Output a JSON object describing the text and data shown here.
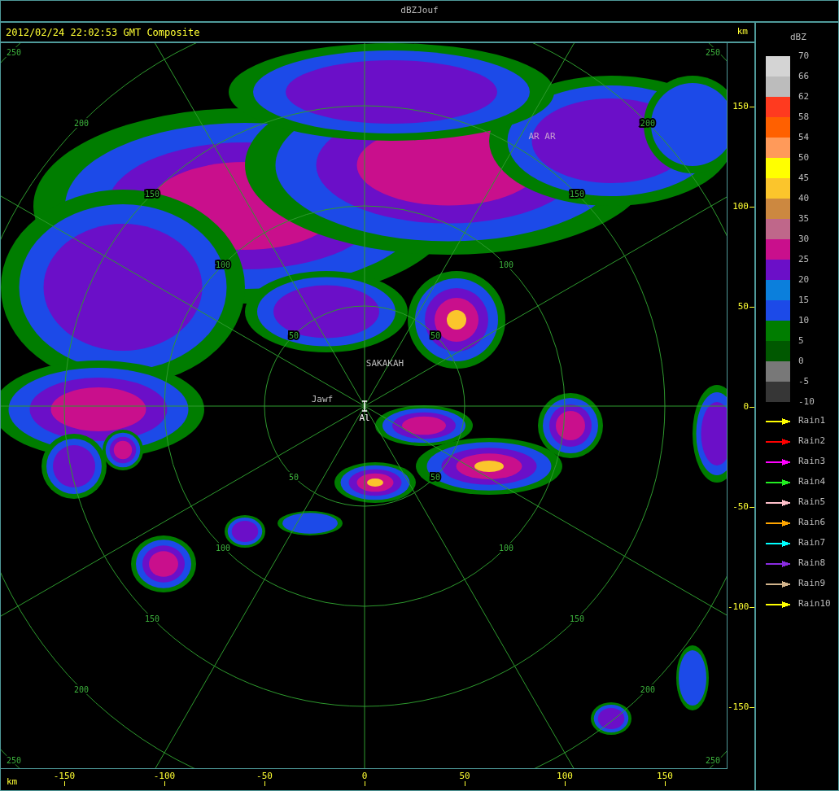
{
  "window": {
    "title": "dBZJouf"
  },
  "header": {
    "timestamp": "2012/02/24 22:02:53 GMT Composite"
  },
  "map": {
    "ring_labels": {
      "nw": [
        "50",
        "100",
        "150",
        "200",
        "250"
      ],
      "ne": [
        "50",
        "100",
        "150",
        "200",
        "250"
      ],
      "sw": [
        "50",
        "100",
        "150",
        "200",
        "250"
      ],
      "se": [
        "50",
        "100",
        "150",
        "200",
        "250"
      ]
    },
    "places": [
      {
        "name": "SAKAKAH"
      },
      {
        "name": "AR AR"
      },
      {
        "name": "Jawf"
      },
      {
        "name": "Al"
      }
    ]
  },
  "y_axis": {
    "unit": "km",
    "ticks": [
      "150",
      "100",
      "50",
      "0",
      "-50",
      "-100",
      "-150"
    ]
  },
  "x_axis": {
    "unit": "km",
    "ticks": [
      "-150",
      "-100",
      "-50",
      "0",
      "50",
      "100",
      "150"
    ]
  },
  "legend": {
    "title": "dBZ",
    "bottom_label": "-10",
    "bins": [
      {
        "label": "70",
        "color": "#d4d4d4"
      },
      {
        "label": "66",
        "color": "#bcbcbc"
      },
      {
        "label": "62",
        "color": "#ff3a1f"
      },
      {
        "label": "58",
        "color": "#ff6000"
      },
      {
        "label": "54",
        "color": "#ff9a5a"
      },
      {
        "label": "50",
        "color": "#ffff00"
      },
      {
        "label": "45",
        "color": "#fbc52c"
      },
      {
        "label": "40",
        "color": "#cc8840"
      },
      {
        "label": "35",
        "color": "#bf678a"
      },
      {
        "label": "30",
        "color": "#c90f8c"
      },
      {
        "label": "25",
        "color": "#6b0fc8"
      },
      {
        "label": "20",
        "color": "#0b7fdc"
      },
      {
        "label": "15",
        "color": "#1c4ae8"
      },
      {
        "label": "10",
        "color": "#007d00"
      },
      {
        "label": "5",
        "color": "#005800"
      },
      {
        "label": "0",
        "color": "#787878"
      },
      {
        "label": "-5",
        "color": "#363636"
      }
    ],
    "tracks": [
      {
        "label": "Rain1",
        "color": "#ffff00"
      },
      {
        "label": "Rain2",
        "color": "#ff0000"
      },
      {
        "label": "Rain3",
        "color": "#ff00ff"
      },
      {
        "label": "Rain4",
        "color": "#22ee22"
      },
      {
        "label": "Rain5",
        "color": "#ffc0cb"
      },
      {
        "label": "Rain6",
        "color": "#ffa500"
      },
      {
        "label": "Rain7",
        "color": "#00ffff"
      },
      {
        "label": "Rain8",
        "color": "#8a2be2"
      },
      {
        "label": "Rain9",
        "color": "#d2b48c"
      },
      {
        "label": "Rain10",
        "color": "#ffff00"
      }
    ]
  }
}
